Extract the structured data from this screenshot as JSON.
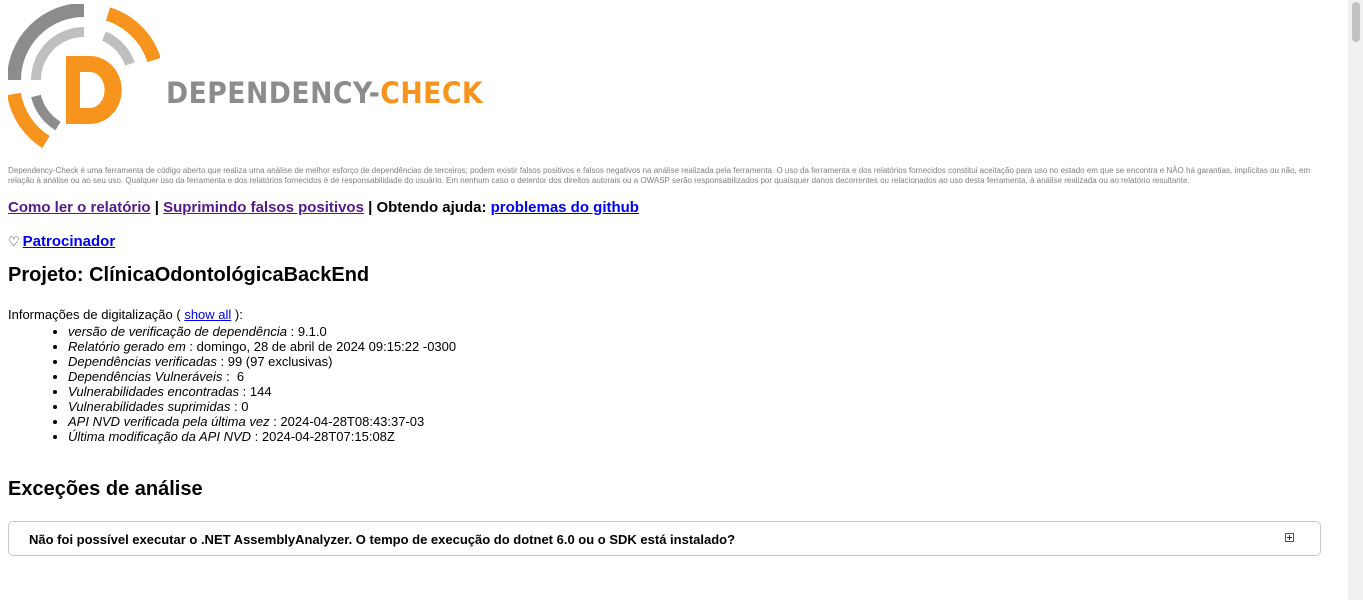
{
  "header": {
    "logo_part1": "DEPENDENCY-",
    "logo_part2": "CHECK",
    "disclaimer": "Dependency-Check é uma ferramenta de código aberto que realiza uma análise de melhor esforço de dependências de terceiros; podem existir falsos positivos e falsos negativos na análise realizada pela ferramenta. O uso da ferramenta e dos relatórios fornecidos constitui aceitação para uso no estado em que se encontra e NÃO há garantias, implícitas ou não, em relação à análise ou ao seu uso. Qualquer uso da ferramenta e dos relatórios fornecidos é de responsabilidade do usuário. Em nenhum caso o detentor dos direitos autorais ou a OWASP serão responsabilizados por quaisquer danos decorrentes ou relacionados ao uso desta ferramenta, à análise realizada ou ao relatório resultante."
  },
  "links": {
    "how_to_read": "Como ler o relatório",
    "sep1": " | ",
    "suppress": "Suprimindo falsos positivos",
    "sep2": " | Obtendo ajuda: ",
    "github": "problemas do github"
  },
  "sponsor": {
    "icon": "♡",
    "label": "Patrocinador"
  },
  "project": {
    "title": "Projeto: ClínicaOdontológicaBackEnd"
  },
  "scan_info": {
    "prefix": "Informações de digitalização ( ",
    "show_all": "show all",
    "suffix": " ):",
    "items": [
      {
        "label": "versão de verificação de dependência",
        "value": " : 9.1.0"
      },
      {
        "label": "Relatório gerado em",
        "value": " : domingo, 28 de abril de 2024 09:15:22 -0300"
      },
      {
        "label": "Dependências verificadas",
        "value": " : 99 (97 exclusivas)"
      },
      {
        "label": "Dependências Vulneráveis",
        "value": " :  6"
      },
      {
        "label": "Vulnerabilidades encontradas",
        "value": " : 144"
      },
      {
        "label": "Vulnerabilidades suprimidas",
        "value": " : 0"
      },
      {
        "label": "API NVD verificada pela última vez",
        "value": " : 2024-04-28T08:43:37-03"
      },
      {
        "label": "Última modificação da API NVD",
        "value": " : 2024-04-28T07:15:08Z"
      }
    ]
  },
  "exceptions": {
    "title": "Exceções de análise",
    "items": [
      {
        "text": "Não foi possível executar o .NET AssemblyAnalyzer. O tempo de execução do dotnet 6.0 ou o SDK está instalado?"
      }
    ]
  },
  "colors": {
    "brand_orange": "#f7941d",
    "brand_gray": "#8c8c8c",
    "link_visited": "#551a8b",
    "link": "#0000ee"
  },
  "icons": {
    "logo": "dependency-check-logo",
    "sponsor": "heart-icon",
    "expand": "expand-plus-icon"
  }
}
